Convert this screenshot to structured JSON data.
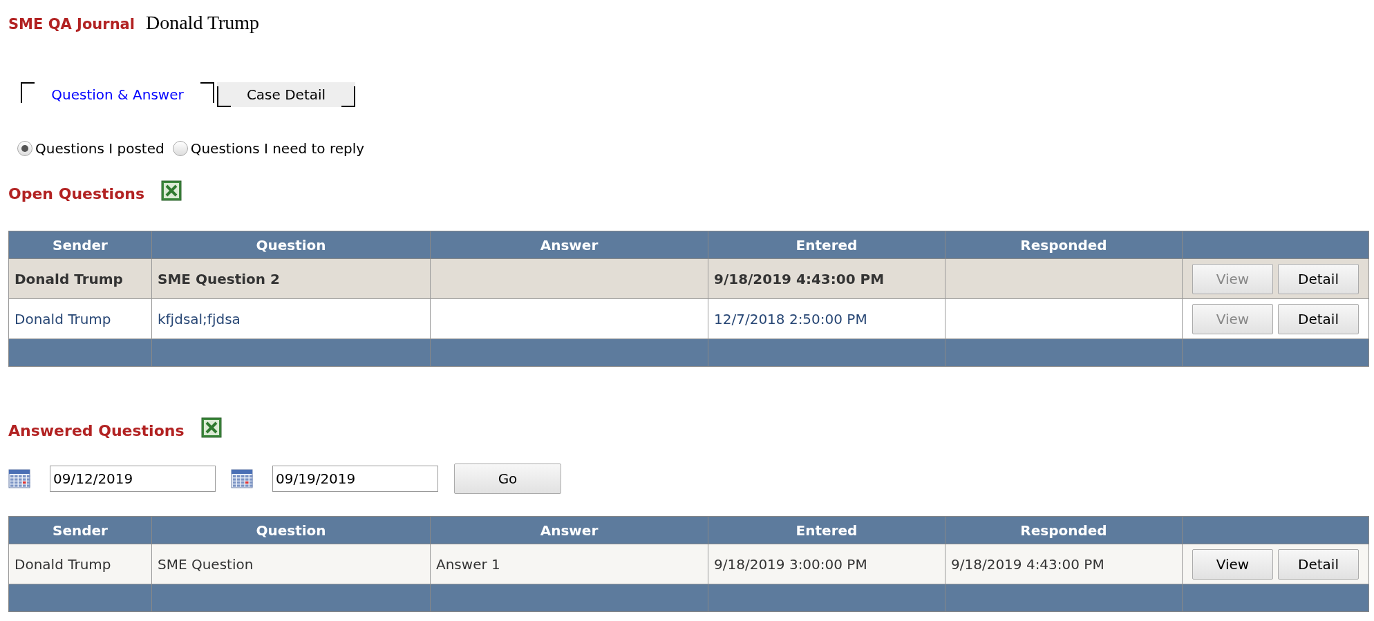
{
  "header": {
    "app_title": "SME QA Journal",
    "user_name": "Donald Trump"
  },
  "tabs": [
    {
      "label": "Question & Answer",
      "selected": true
    },
    {
      "label": "Case Detail",
      "selected": false
    }
  ],
  "filter": [
    {
      "label": "Questions I posted",
      "selected": true
    },
    {
      "label": "Questions I need to reply",
      "selected": false
    }
  ],
  "open_questions": {
    "title": "Open Questions",
    "table": {
      "columns": [
        "Sender",
        "Question",
        "Answer",
        "Entered",
        "Responded"
      ],
      "rows": [
        {
          "kind": "selected",
          "cells": [
            "Donald Trump",
            "SME Question 2",
            "",
            "9/18/2019 4:43:00 PM",
            ""
          ],
          "buttons": [
            {
              "label": "View",
              "disabled": true
            },
            {
              "label": "Detail",
              "disabled": false
            }
          ]
        },
        {
          "kind": "link",
          "cells": [
            "Donald Trump",
            "kfjdsal;fjdsa",
            "",
            "12/7/2018 2:50:00 PM",
            ""
          ],
          "buttons": [
            {
              "label": "View",
              "disabled": true
            },
            {
              "label": "Detail",
              "disabled": false
            }
          ]
        }
      ]
    }
  },
  "answered_questions": {
    "title": "Answered Questions",
    "from_date": "09/12/2019",
    "to_date": "09/19/2019",
    "go_button": "Go",
    "table": {
      "columns": [
        "Sender",
        "Question",
        "Answer",
        "Entered",
        "Responded"
      ],
      "rows": [
        {
          "kind": "plain",
          "cells": [
            "Donald Trump",
            "SME Question",
            "Answer 1",
            "9/18/2019 3:00:00 PM",
            "9/18/2019 4:43:00 PM"
          ],
          "buttons": [
            {
              "label": "View",
              "disabled": false
            },
            {
              "label": "Detail",
              "disabled": false
            }
          ]
        }
      ]
    }
  }
}
